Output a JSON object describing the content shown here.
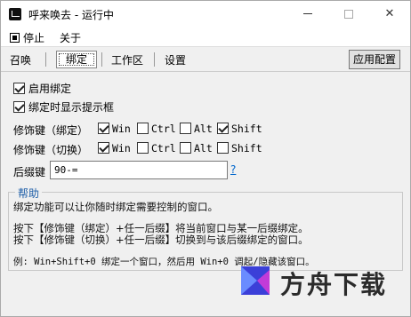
{
  "window": {
    "title": "呼来唤去 - 运行中"
  },
  "menu": {
    "stop_label": "停止",
    "about_label": "关于"
  },
  "tabs": {
    "summon": "召唤",
    "bind": "绑定",
    "workarea": "工作区",
    "settings": "设置",
    "active": "绑定"
  },
  "toolbar": {
    "apply_label": "应用配置"
  },
  "options": {
    "enable_bind": {
      "label": "启用绑定",
      "checked": true
    },
    "show_tooltip": {
      "label": "绑定时显示提示框",
      "checked": true
    }
  },
  "modifiers": {
    "bind": {
      "label": "修饰键（绑定）",
      "win": {
        "label": "Win",
        "checked": true
      },
      "ctrl": {
        "label": "Ctrl",
        "checked": false
      },
      "alt": {
        "label": "Alt",
        "checked": false
      },
      "shift": {
        "label": "Shift",
        "checked": true
      }
    },
    "switch": {
      "label": "修饰键（切换）",
      "win": {
        "label": "Win",
        "checked": true
      },
      "ctrl": {
        "label": "Ctrl",
        "checked": false
      },
      "alt": {
        "label": "Alt",
        "checked": false
      },
      "shift": {
        "label": "Shift",
        "checked": false
      }
    }
  },
  "suffix": {
    "label": "后缀键",
    "value": "90-=",
    "help_link": "?"
  },
  "help": {
    "title": "帮助",
    "line1": "绑定功能可以让你随时绑定需要控制的窗口。",
    "line2": "按下【修饰键（绑定）+任一后缀】将当前窗口与某一后缀绑定。",
    "line3": "按下【修饰键（切换）+任一后缀】切换到与该后缀绑定的窗口。",
    "line4": "例: Win+Shift+0 绑定一个窗口，然后用 Win+0 调起/隐藏该窗口。"
  },
  "watermark": {
    "text": "方舟下载"
  },
  "colors": {
    "link": "#0066cc",
    "group_title": "#1f5fa8",
    "background": "#f0f0f0"
  }
}
